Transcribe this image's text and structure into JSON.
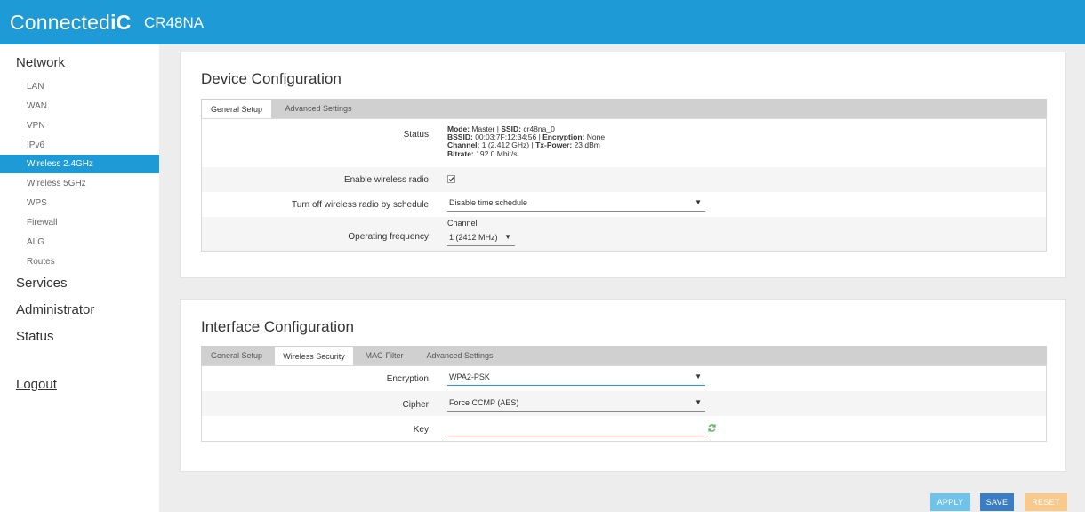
{
  "header": {
    "brand_prefix": "Connected",
    "brand_suffix": "iC",
    "model": "CR48NA"
  },
  "sidebar": {
    "network_label": "Network",
    "network_items": [
      "LAN",
      "WAN",
      "VPN",
      "IPv6",
      "Wireless 2.4GHz",
      "Wireless 5GHz",
      "WPS",
      "Firewall",
      "ALG",
      "Routes"
    ],
    "active_item": "Wireless 2.4GHz",
    "services_label": "Services",
    "administrator_label": "Administrator",
    "status_label": "Status",
    "logout_label": "Logout"
  },
  "device_config": {
    "title": "Device Configuration",
    "tabs": [
      "General Setup",
      "Advanced Settings"
    ],
    "active_tab": "General Setup",
    "status_label": "Status",
    "status": {
      "mode_key": "Mode:",
      "mode_val": "Master",
      "ssid_key": "SSID:",
      "ssid_val": "cr48na_0",
      "bssid_key": "BSSID:",
      "bssid_val": "00:03:7F:12:34:56",
      "enc_key": "Encryption:",
      "enc_val": "None",
      "channel_key": "Channel:",
      "channel_val": "1 (2.412 GHz)",
      "txpower_key": "Tx-Power:",
      "txpower_val": "23 dBm",
      "bitrate_key": "Bitrate:",
      "bitrate_val": "192.0 Mbit/s"
    },
    "enable_radio_label": "Enable wireless radio",
    "enable_radio_checked": true,
    "schedule_label": "Turn off wireless radio by schedule",
    "schedule_value": "Disable time schedule",
    "freq_label": "Operating frequency",
    "channel_caption": "Channel",
    "channel_value": "1 (2412 MHz)"
  },
  "interface_config": {
    "title": "Interface Configuration",
    "tabs": [
      "General Setup",
      "Wireless Security",
      "MAC-Filter",
      "Advanced Settings"
    ],
    "active_tab": "Wireless Security",
    "encryption_label": "Encryption",
    "encryption_value": "WPA2-PSK",
    "cipher_label": "Cipher",
    "cipher_value": "Force CCMP (AES)",
    "key_label": "Key",
    "key_value": ""
  },
  "buttons": {
    "apply": "APPLY",
    "save": "SAVE",
    "reset": "RESET"
  },
  "colors": {
    "header_bg": "#1e9bd7",
    "active_nav": "#1e9bd7",
    "apply_btn": "#6fc2ea",
    "save_btn": "#3b7dc4",
    "reset_btn": "#f8c98a",
    "key_invalid": "#e53935"
  },
  "icons": {
    "dropdown": "chevron-down-icon",
    "checkbox": "checkbox-checked-icon",
    "key_generate": "refresh-icon"
  }
}
